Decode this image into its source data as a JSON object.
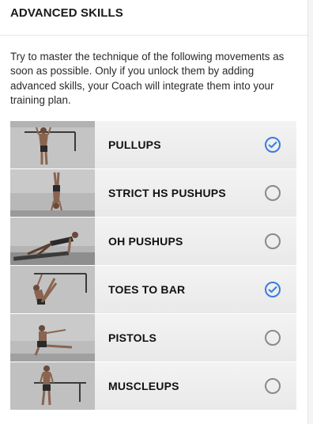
{
  "header": {
    "title": "ADVANCED SKILLS"
  },
  "intro": "Try to master the technique of the following movements as soon as possible. Only if you unlock them by adding advanced skills, your Coach will integrate them into your training plan.",
  "colors": {
    "accent": "#3a7be0",
    "unchecked": "#8a8a8a"
  },
  "skills": [
    {
      "label": "PULLUPS",
      "selected": true,
      "image": "pullups-photo"
    },
    {
      "label": "STRICT HS PUSHUPS",
      "selected": false,
      "image": "handstand-pushups-photo"
    },
    {
      "label": "OH PUSHUPS",
      "selected": false,
      "image": "one-hand-pushups-photo"
    },
    {
      "label": "TOES TO BAR",
      "selected": true,
      "image": "toes-to-bar-photo"
    },
    {
      "label": "PISTOLS",
      "selected": false,
      "image": "pistol-squat-photo"
    },
    {
      "label": "MUSCLEUPS",
      "selected": false,
      "image": "muscleups-photo"
    }
  ]
}
